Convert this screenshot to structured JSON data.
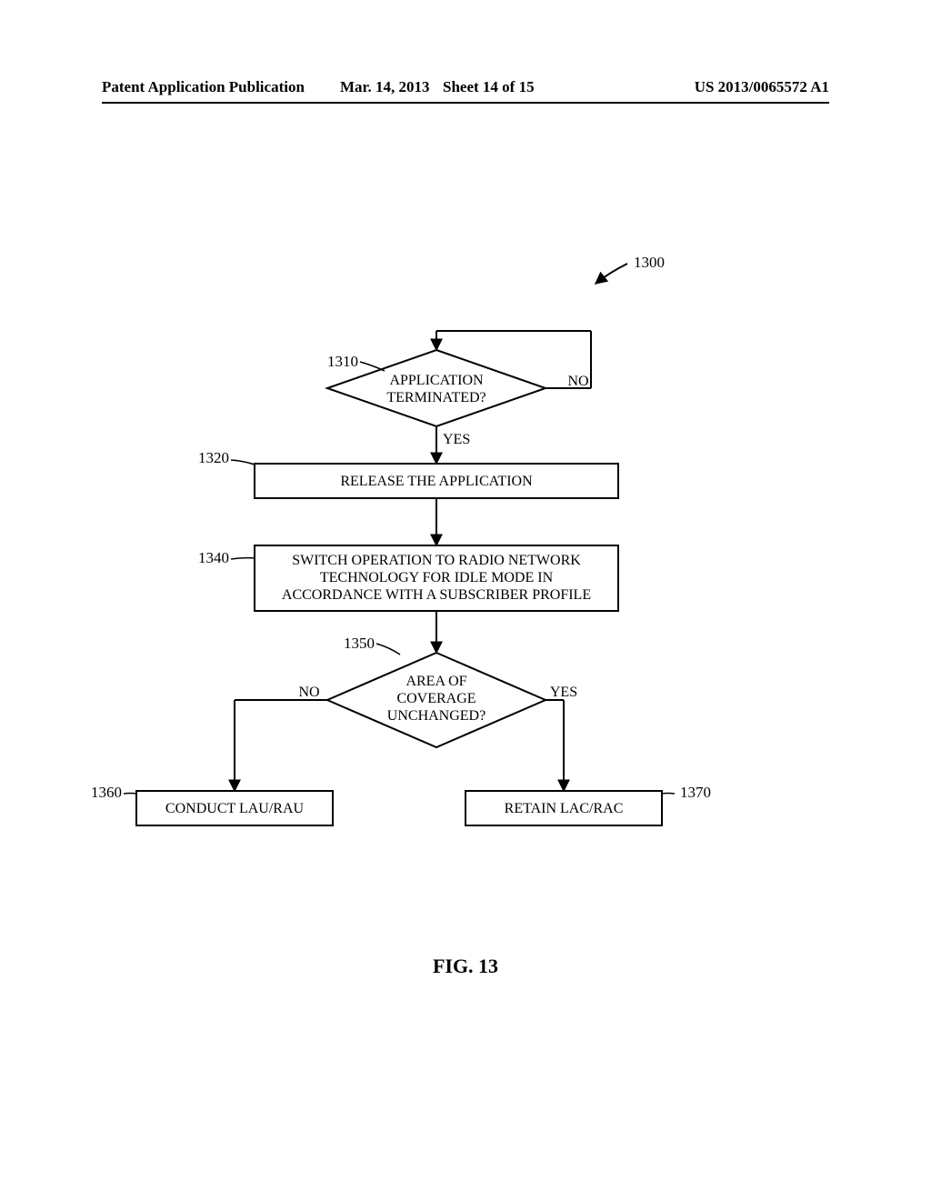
{
  "header": {
    "pub_type": "Patent Application Publication",
    "date": "Mar. 14, 2013",
    "sheet": "Sheet 14 of 15",
    "pub_number": "US 2013/0065572 A1"
  },
  "refs": {
    "figure_overall": "1300",
    "decision_terminated": "1310",
    "release_app": "1320",
    "switch_operation": "1340",
    "decision_coverage": "1350",
    "conduct_lau": "1360",
    "retain_lac": "1370"
  },
  "nodes": {
    "decision_terminated": {
      "line1": "APPLICATION",
      "line2": "TERMINATED?"
    },
    "release_app": {
      "text": "RELEASE THE APPLICATION"
    },
    "switch_operation": {
      "line1": "SWITCH OPERATION TO RADIO NETWORK",
      "line2": "TECHNOLOGY FOR IDLE MODE IN",
      "line3": "ACCORDANCE WITH A SUBSCRIBER PROFILE"
    },
    "decision_coverage": {
      "line1": "AREA OF",
      "line2": "COVERAGE",
      "line3": "UNCHANGED?"
    },
    "conduct_lau": {
      "text": "CONDUCT LAU/RAU"
    },
    "retain_lac": {
      "text": "RETAIN LAC/RAC"
    }
  },
  "edges": {
    "no": "NO",
    "yes": "YES"
  },
  "caption": "FIG. 13"
}
